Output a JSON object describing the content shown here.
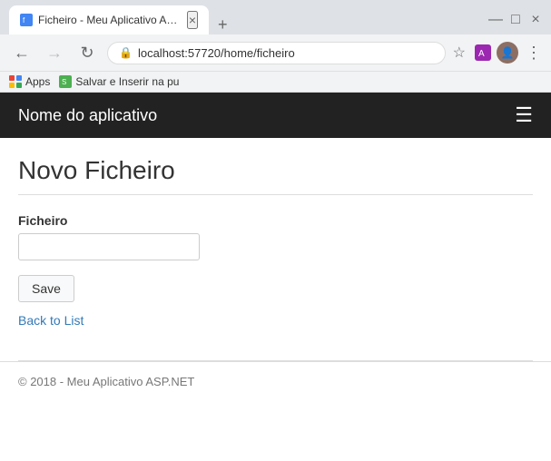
{
  "browser": {
    "tab": {
      "title": "Ficheiro - Meu Aplicativo ASP.NE",
      "close_label": "×"
    },
    "tab_new_label": "+",
    "window_controls": {
      "minimize": "—",
      "maximize": "□",
      "close": "×"
    },
    "nav": {
      "back_label": "←",
      "forward_label": "→",
      "refresh_label": "↻"
    },
    "address": "localhost:57720/home/ficheiro",
    "star_label": "☆",
    "menu_label": "⋮",
    "bookmarks": [
      {
        "label": "Apps"
      },
      {
        "label": "Salvar e Inserir na pu"
      }
    ]
  },
  "navbar": {
    "brand": "Nome do aplicativo",
    "toggle_icon": "☰"
  },
  "page": {
    "title": "Novo Ficheiro",
    "form": {
      "label": "Ficheiro",
      "input_value": "",
      "input_placeholder": ""
    },
    "save_button": "Save",
    "back_link": "Back to List"
  },
  "footer": {
    "text": "© 2018 - Meu Aplicativo ASP.NET"
  }
}
